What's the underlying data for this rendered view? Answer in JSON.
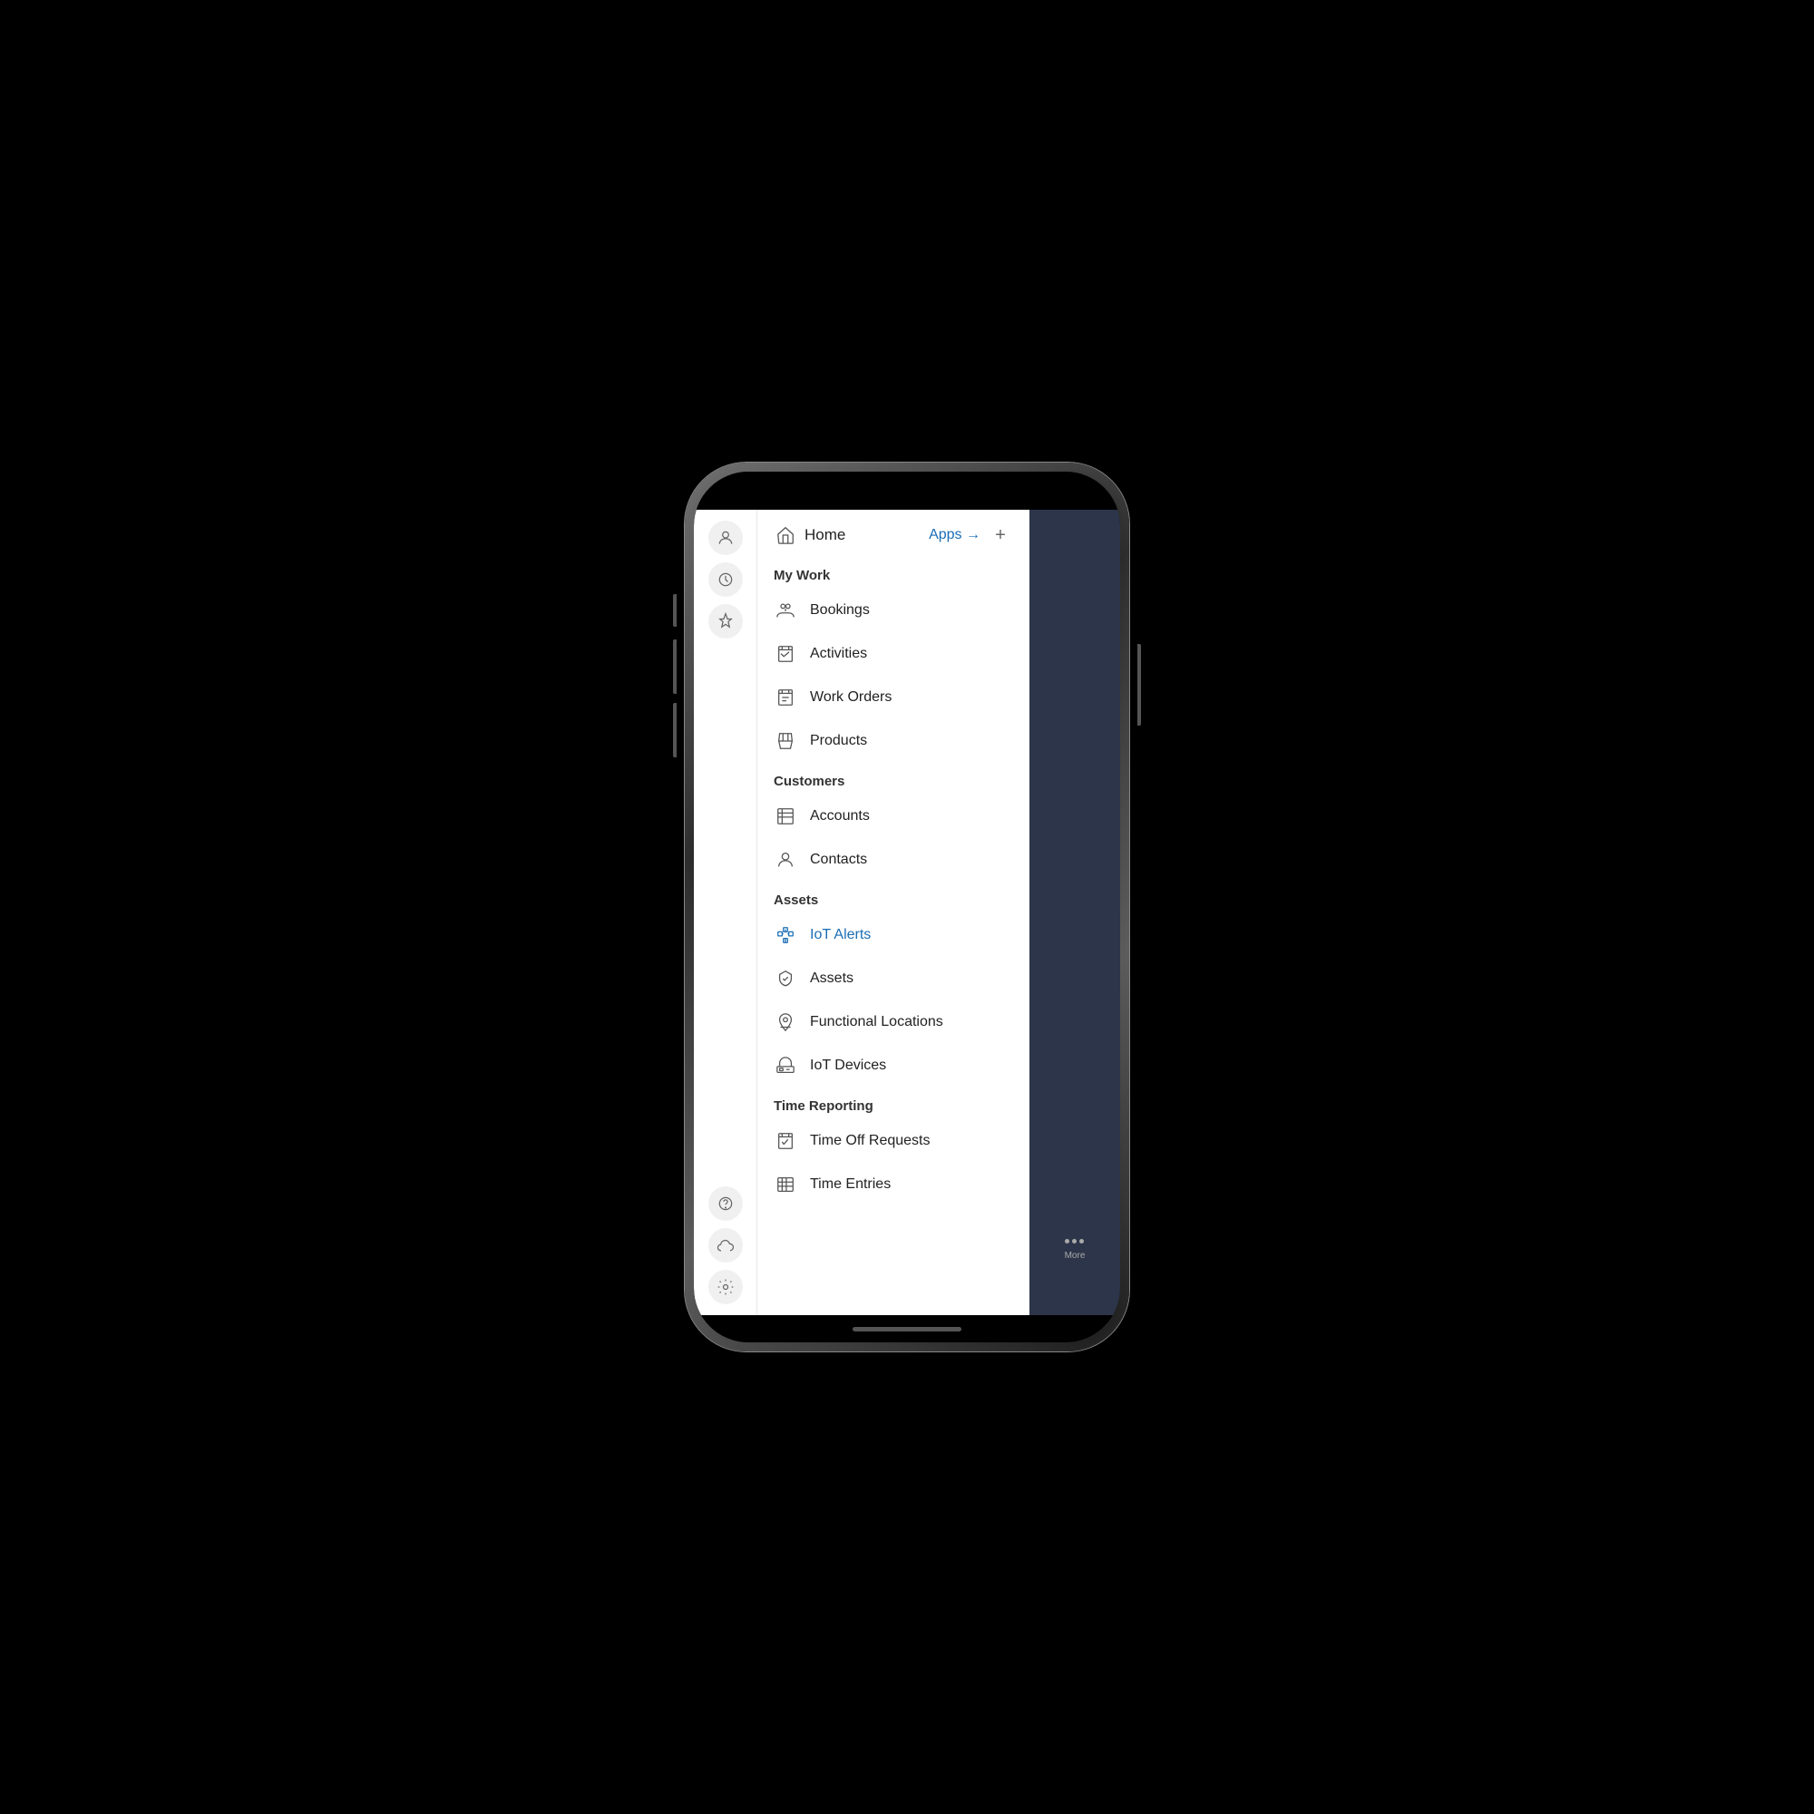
{
  "phone": {
    "notch": true
  },
  "header": {
    "home_label": "Home",
    "apps_label": "Apps →",
    "plus_label": "+"
  },
  "sections": [
    {
      "id": "my-work",
      "label": "My Work",
      "items": [
        {
          "id": "bookings",
          "label": "Bookings",
          "icon": "bookings",
          "active": false
        },
        {
          "id": "activities",
          "label": "Activities",
          "icon": "activities",
          "active": false
        },
        {
          "id": "work-orders",
          "label": "Work Orders",
          "icon": "work-orders",
          "active": false
        },
        {
          "id": "products",
          "label": "Products",
          "icon": "products",
          "active": false
        }
      ]
    },
    {
      "id": "customers",
      "label": "Customers",
      "items": [
        {
          "id": "accounts",
          "label": "Accounts",
          "icon": "accounts",
          "active": false
        },
        {
          "id": "contacts",
          "label": "Contacts",
          "icon": "contacts",
          "active": false
        }
      ]
    },
    {
      "id": "assets",
      "label": "Assets",
      "items": [
        {
          "id": "iot-alerts",
          "label": "IoT Alerts",
          "icon": "iot-alerts",
          "active": true
        },
        {
          "id": "assets",
          "label": "Assets",
          "icon": "assets",
          "active": false
        },
        {
          "id": "functional-locations",
          "label": "Functional Locations",
          "icon": "functional-locations",
          "active": false
        },
        {
          "id": "iot-devices",
          "label": "IoT Devices",
          "icon": "iot-devices",
          "active": false
        }
      ]
    },
    {
      "id": "time-reporting",
      "label": "Time Reporting",
      "items": [
        {
          "id": "time-off-requests",
          "label": "Time Off Requests",
          "icon": "time-off-requests",
          "active": false
        },
        {
          "id": "time-entries",
          "label": "Time Entries",
          "icon": "time-entries",
          "active": false
        }
      ]
    }
  ],
  "sidebar_icons": [
    "person",
    "clock",
    "pin"
  ],
  "sidebar_bottom_icons": [
    "help",
    "cloud",
    "settings"
  ],
  "bottom": {
    "more_label": "More"
  },
  "colors": {
    "active": "#1a6db5",
    "text": "#222",
    "section": "#333",
    "icon": "#555",
    "bg": "#fff"
  }
}
